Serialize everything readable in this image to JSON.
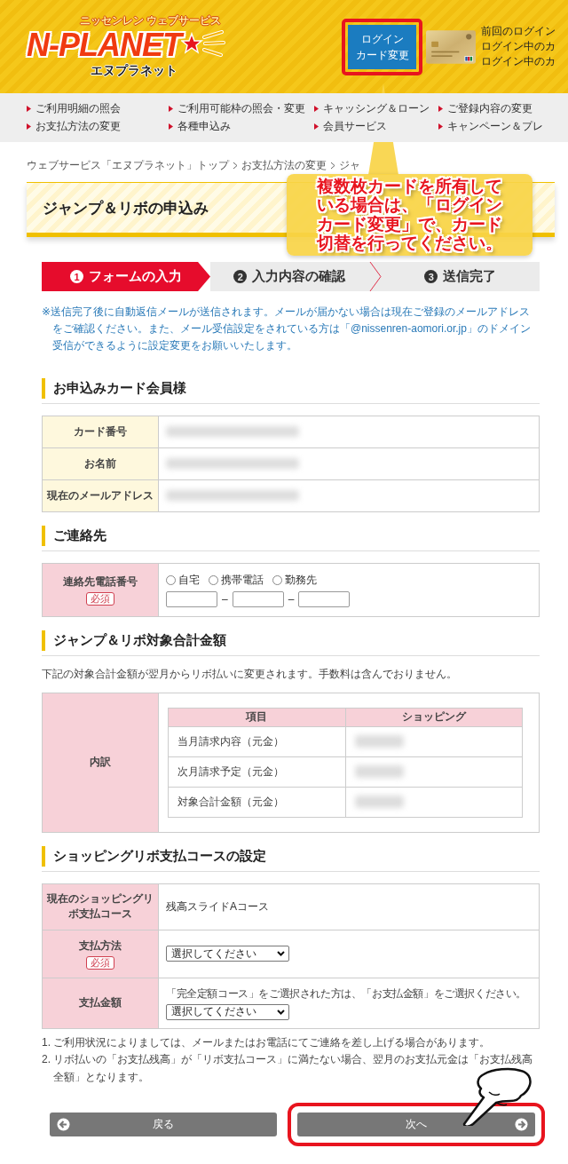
{
  "header": {
    "logo": {
      "tagline": "ニッセンレン ウェブサービス",
      "wordmark": "N-PLANET",
      "reading": "エヌプラネット"
    },
    "login_card_button": {
      "lines": [
        "ログイン",
        "カード変更"
      ]
    },
    "login_info": [
      "前回のログイン",
      "ログイン中のカ",
      "ログイン中のカ"
    ]
  },
  "nav": {
    "columns": [
      [
        "ご利用明細の照会",
        "お支払方法の変更"
      ],
      [
        "ご利用可能枠の照会・変更",
        "各種申込み"
      ],
      [
        "キャッシング＆ローン",
        "会員サービス"
      ],
      [
        "ご登録内容の変更",
        "キャンペーン＆プレ"
      ]
    ]
  },
  "breadcrumb": [
    "ウェブサービス「エヌプラネット」トップ",
    "お支払方法の変更",
    "ジャ"
  ],
  "page_title": "ジャンプ＆リボの申込み",
  "callout": "複数枚カードを所有している場合は、「ログインカード変更」で、カード切替を行ってください。",
  "steps": [
    {
      "number": "1",
      "label": "フォームの入力",
      "selected": true
    },
    {
      "number": "2",
      "label": "入力内容の確認",
      "selected": false
    },
    {
      "number": "3",
      "label": "送信完了",
      "selected": false
    }
  ],
  "notice": "※送信完了後に自動返信メールが送信されます。メールが届かない場合は現在ご登録のメールアドレスをご確認ください。また、メール受信設定をされている方は「@nissenren-aomori.or.jp」のドメイン受信ができるように設定変更をお願いいたします。",
  "member_section": {
    "heading": "お申込みカード会員様",
    "rows": [
      "カード番号",
      "お名前",
      "現在のメールアドレス"
    ]
  },
  "contact_section": {
    "heading": "ご連絡先",
    "label": "連絡先電話番号",
    "required_badge": "必須",
    "phone_types": [
      {
        "label": "自宅",
        "selected": false
      },
      {
        "label": "携帯電話",
        "selected": false
      },
      {
        "label": "勤務先",
        "selected": false
      }
    ],
    "phone_separators": [
      "–",
      "–"
    ]
  },
  "total_section": {
    "heading": "ジャンプ＆リボ対象合計金額",
    "description": "下記の対象合計金額が翌月からリボ払いに変更されます。手数料は含んでおりません。",
    "label": "内訳",
    "columns": [
      "項目",
      "ショッピング"
    ],
    "rows": [
      "当月請求内容（元金）",
      "次月請求予定（元金）",
      "対象合計金額（元金）"
    ]
  },
  "course_section": {
    "heading": "ショッピングリボ支払コースの設定",
    "rows": [
      {
        "kind": "text",
        "label": "現在のショッピングリボ支払コース",
        "value": "残高スライドAコース"
      },
      {
        "kind": "select",
        "label": "支払方法",
        "required_badge": "必須",
        "value": "選択してください"
      },
      {
        "kind": "select",
        "label": "支払金額",
        "hint": "「完全定額コース」をご選択された方は、「お支払金額」をご選択ください。",
        "value": "選択してください"
      }
    ]
  },
  "notes": [
    {
      "number": "1.",
      "text": "ご利用状況によりましては、メールまたはお電話にてご連絡を差し上げる場合があります。"
    },
    {
      "number": "2.",
      "text": "リボ払いの「お支払残高」が「リボ支払コース」に満たない場合、翌月のお支払元金は「お支払残高全額」となります。"
    }
  ],
  "buttons": [
    {
      "kind": "back",
      "label": "戻る",
      "highlighted": false
    },
    {
      "kind": "next",
      "label": "次へ",
      "highlighted": true
    }
  ]
}
